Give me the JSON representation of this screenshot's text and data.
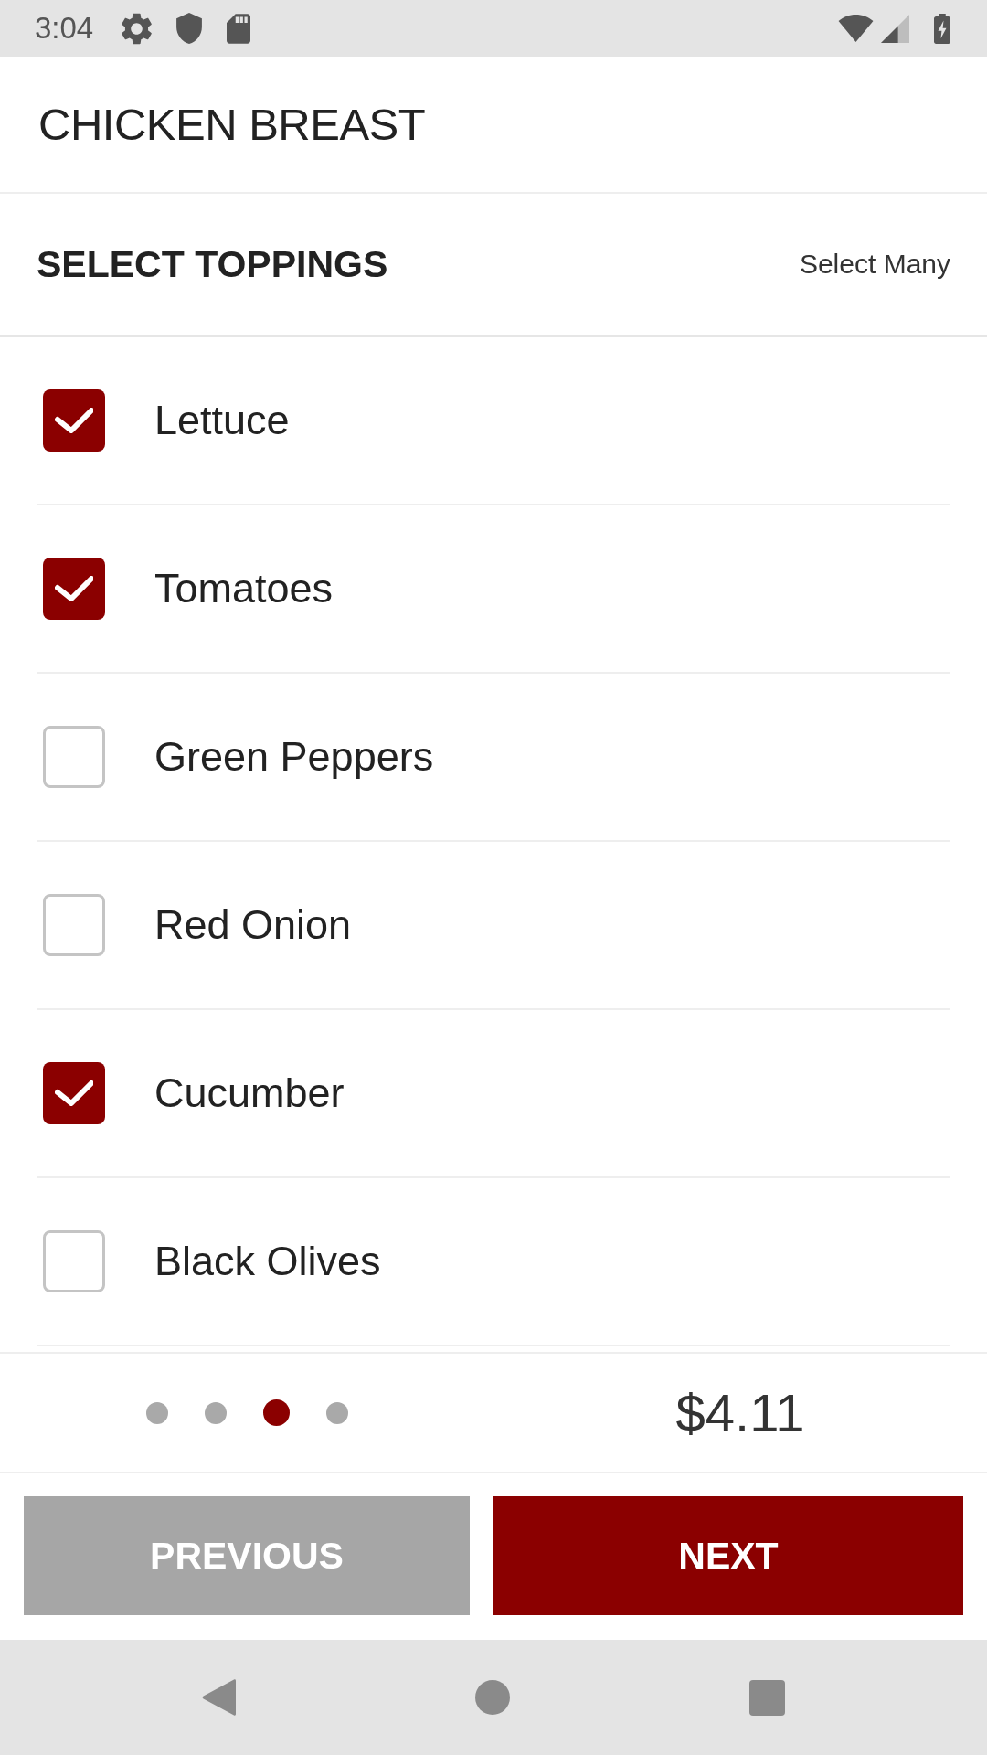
{
  "status_bar": {
    "time": "3:04"
  },
  "header": {
    "title": "CHICKEN BREAST"
  },
  "section": {
    "title": "SELECT TOPPINGS",
    "hint": "Select Many"
  },
  "toppings": [
    {
      "label": "Lettuce",
      "checked": true
    },
    {
      "label": "Tomatoes",
      "checked": true
    },
    {
      "label": "Green Peppers",
      "checked": false
    },
    {
      "label": "Red Onion",
      "checked": false
    },
    {
      "label": "Cucumber",
      "checked": true
    },
    {
      "label": "Black Olives",
      "checked": false
    }
  ],
  "footer": {
    "pager": [
      {
        "selected": false
      },
      {
        "selected": false
      },
      {
        "selected": true
      },
      {
        "selected": false
      }
    ],
    "price": "$4.11"
  },
  "buttons": [
    {
      "label": "PREVIOUS",
      "kind": "secondary"
    },
    {
      "label": "NEXT",
      "kind": "primary"
    }
  ]
}
